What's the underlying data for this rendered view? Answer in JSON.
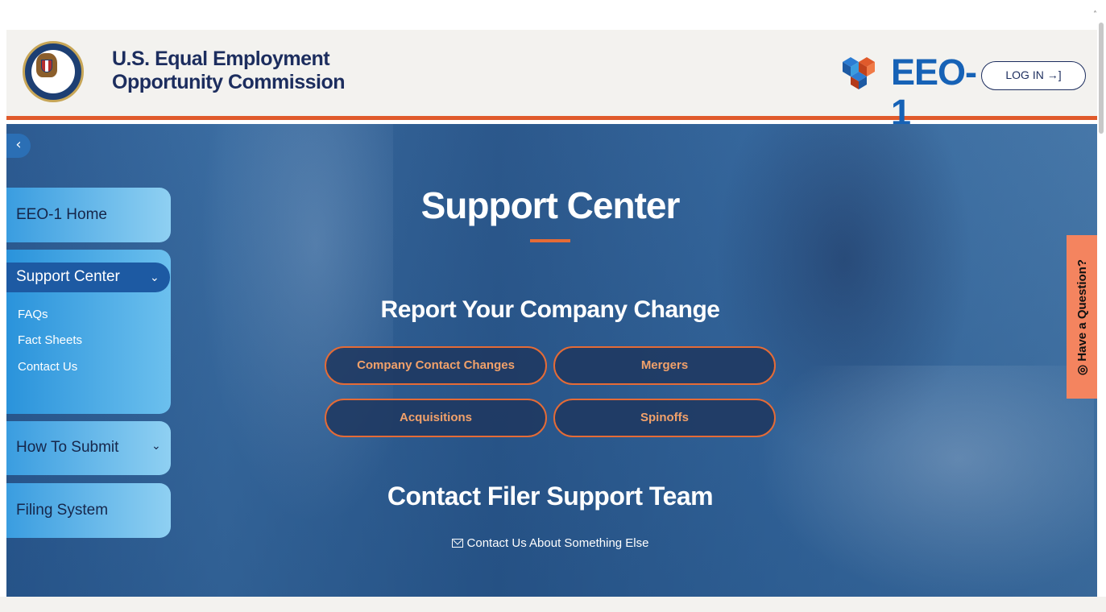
{
  "header": {
    "agency_line1": "U.S. Equal Employment",
    "agency_line2": "Opportunity Commission",
    "brand": "EEO-1",
    "login_label": "LOG IN",
    "colors": {
      "accent": "#e05a2b",
      "brand_blue": "#1662b6",
      "navy": "#1c2d5e"
    }
  },
  "sidebar": {
    "toggle_icon": "chevron-left-icon",
    "items": [
      {
        "label": "EEO-1 Home"
      },
      {
        "label": "Support Center",
        "expanded": true,
        "children": [
          {
            "label": "FAQs"
          },
          {
            "label": "Fact Sheets"
          },
          {
            "label": "Contact Us"
          }
        ]
      },
      {
        "label": "How To Submit"
      },
      {
        "label": "Filing System"
      }
    ]
  },
  "hero": {
    "title": "Support Center",
    "subtitle": "Report Your Company Change",
    "buttons": [
      {
        "label": "Company Contact Changes"
      },
      {
        "label": "Mergers"
      },
      {
        "label": "Acquisitions"
      },
      {
        "label": "Spinoffs"
      }
    ],
    "contact_title": "Contact Filer Support Team",
    "contact_link": "Contact Us About Something Else"
  },
  "question_tab": {
    "label": "Have a Question?"
  }
}
